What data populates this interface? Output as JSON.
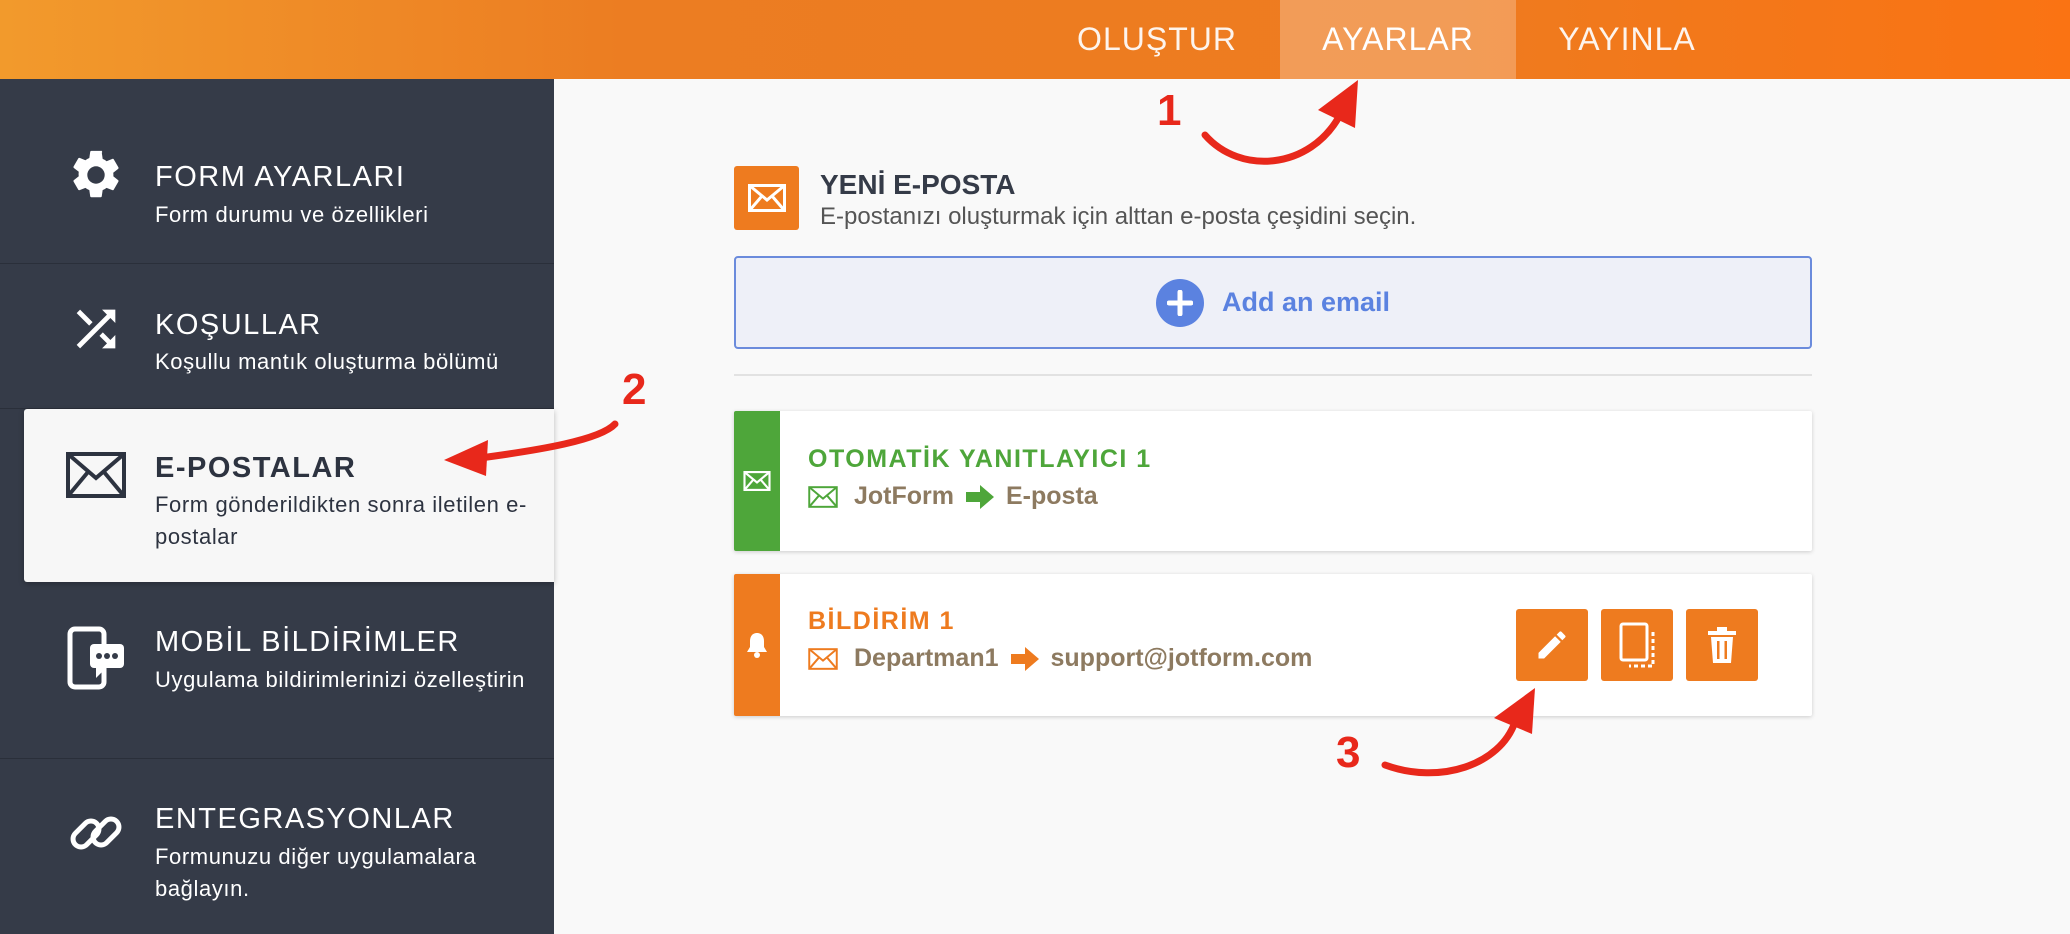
{
  "topbar": {
    "tabs": [
      {
        "label": "OLUŞTUR",
        "active": false
      },
      {
        "label": "AYARLAR",
        "active": true
      },
      {
        "label": "YAYINLA",
        "active": false
      }
    ],
    "gradient_colors": [
      "#f29a2c",
      "#fa7313"
    ]
  },
  "sidebar": {
    "items": [
      {
        "title": "FORM AYARLARI",
        "desc": "Form durumu ve özellikleri",
        "icon": "gear-icon"
      },
      {
        "title": "KOŞULLAR",
        "desc": "Koşullu mantık oluşturma bölümü",
        "icon": "shuffle-icon"
      },
      {
        "title": "E-POSTALAR",
        "desc": "Form gönderildikten sonra iletilen e-postalar",
        "icon": "envelope-icon",
        "active": true
      },
      {
        "title": "MOBİL BİLDİRİMLER",
        "desc": "Uygulama bildirimlerinizi özelleştirin",
        "icon": "mobile-chat-icon"
      },
      {
        "title": "ENTEGRASYONLAR",
        "desc": "Formunuzu diğer uygulamalara bağlayın.",
        "icon": "link-icon"
      }
    ]
  },
  "main": {
    "new_email": {
      "title": "YENİ E-POSTA",
      "subtitle": "E-postanızı oluşturmak için alttan e-posta çeşidini seçin."
    },
    "add_email_label": "Add an email",
    "cards": [
      {
        "title": "OTOMATİK YANITLAYICI 1",
        "from": "JotForm",
        "to": "E-posta",
        "type": "autoresponder",
        "color": "#4ea63a"
      },
      {
        "title": "BİLDİRİM 1",
        "from": "Departman1",
        "to": "support@jotform.com",
        "type": "notification",
        "color": "#ee7b1f"
      }
    ],
    "card_actions": [
      "edit-icon",
      "clone-icon",
      "trash-icon"
    ]
  },
  "annotations": [
    "1",
    "2",
    "3"
  ],
  "colors": {
    "accent": "#ee7b1f",
    "sidebar_bg": "#353b48",
    "add_blue": "#5b82e0",
    "success_green": "#4ea63a",
    "annotation_red": "#e8281b"
  }
}
